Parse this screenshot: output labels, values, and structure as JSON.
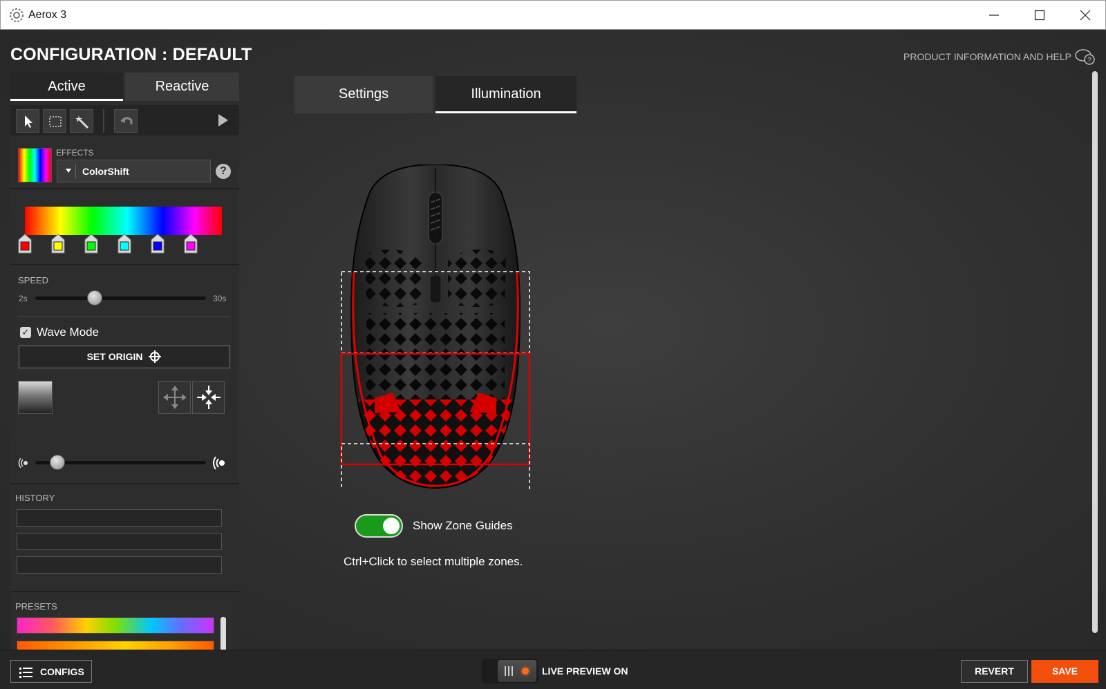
{
  "window": {
    "title": "Aerox 3",
    "app_icon": "steelseries-gear-icon"
  },
  "header": {
    "config_title": "CONFIGURATION : DEFAULT",
    "help_link": "PRODUCT INFORMATION AND HELP"
  },
  "left_tabs": [
    {
      "label": "Active",
      "selected": true
    },
    {
      "label": "Reactive",
      "selected": false
    }
  ],
  "effects": {
    "label": "EFFECTS",
    "selected": "ColorShift",
    "help": "?"
  },
  "gradient_stops": [
    "#ff0000",
    "#ffff00",
    "#00ff00",
    "#00ffff",
    "#0000ff",
    "#ff00ff"
  ],
  "speed": {
    "label": "SPEED",
    "min": "2s",
    "max": "30s",
    "value_fraction": 0.35
  },
  "wave_mode": {
    "label": "Wave Mode",
    "checked": true
  },
  "set_origin": {
    "label": "SET ORIGIN"
  },
  "wave_width_fraction": 0.13,
  "history": {
    "label": "HISTORY"
  },
  "presets": {
    "label": "PRESETS"
  },
  "center_tabs": [
    {
      "label": "Settings",
      "selected": false
    },
    {
      "label": "Illumination",
      "selected": true
    }
  ],
  "zone_guides": {
    "label": "Show Zone Guides",
    "enabled": true
  },
  "hint": "Ctrl+Click to select multiple zones.",
  "bottom": {
    "configs": "CONFIGS",
    "live_preview": "LIVE PREVIEW ON",
    "revert": "REVERT",
    "save": "SAVE"
  },
  "colors": {
    "accent_save": "#f24f0c",
    "toggle_on": "#1a9a1a",
    "zone_selected": "#e00000"
  }
}
